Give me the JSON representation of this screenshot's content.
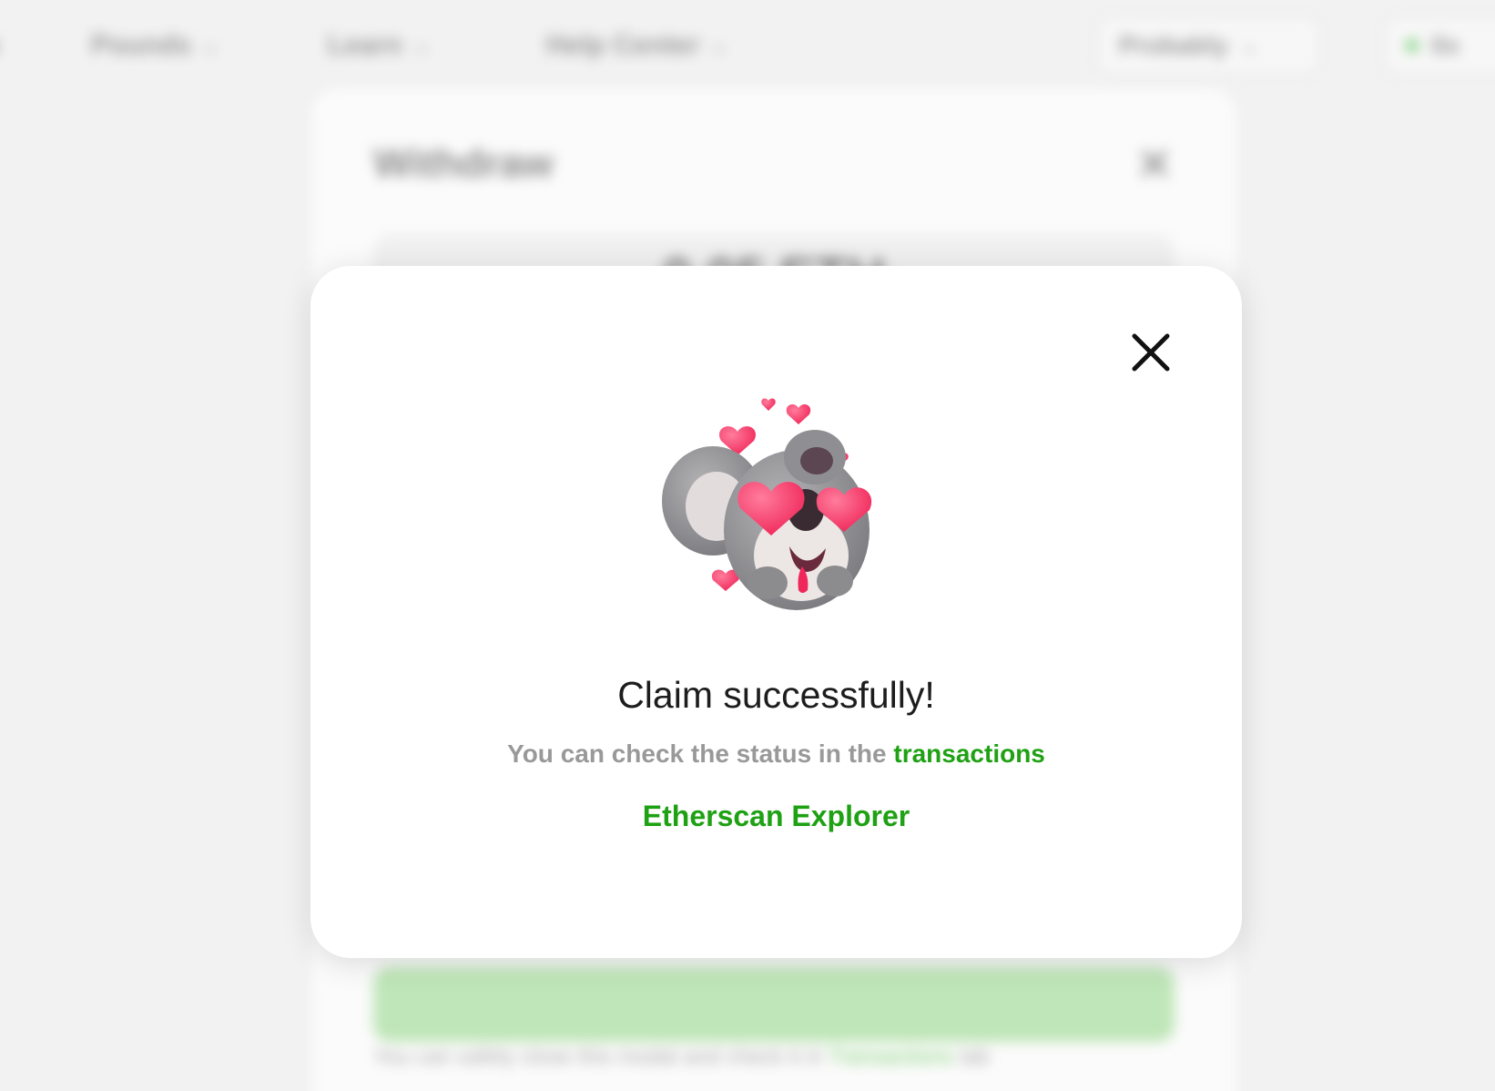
{
  "nav": {
    "items": [
      {
        "label": "Pounds",
        "class": "p"
      },
      {
        "label": "Learn"
      },
      {
        "label": "Help Center"
      }
    ],
    "network_label": "Probably",
    "wallet_label": "0x"
  },
  "background_panel": {
    "title": "Withdraw",
    "amount": "0.05 ETH",
    "footer_text": "You can safely close this modal and check it in",
    "footer_link": "Transactions",
    "footer_suffix": "tab"
  },
  "modal": {
    "title": "Claim successfully!",
    "subtitle_prefix": "You can check the status in the",
    "subtitle_link": "transactions",
    "explorer_link": "Etherscan Explorer"
  },
  "colors": {
    "accent_green": "#1fa114",
    "heart_pink": "#ff3f72",
    "koala_gray": "#8c8c8e"
  },
  "icons": {
    "close": "close-icon",
    "mascot": "koala-hearts-mascot"
  }
}
